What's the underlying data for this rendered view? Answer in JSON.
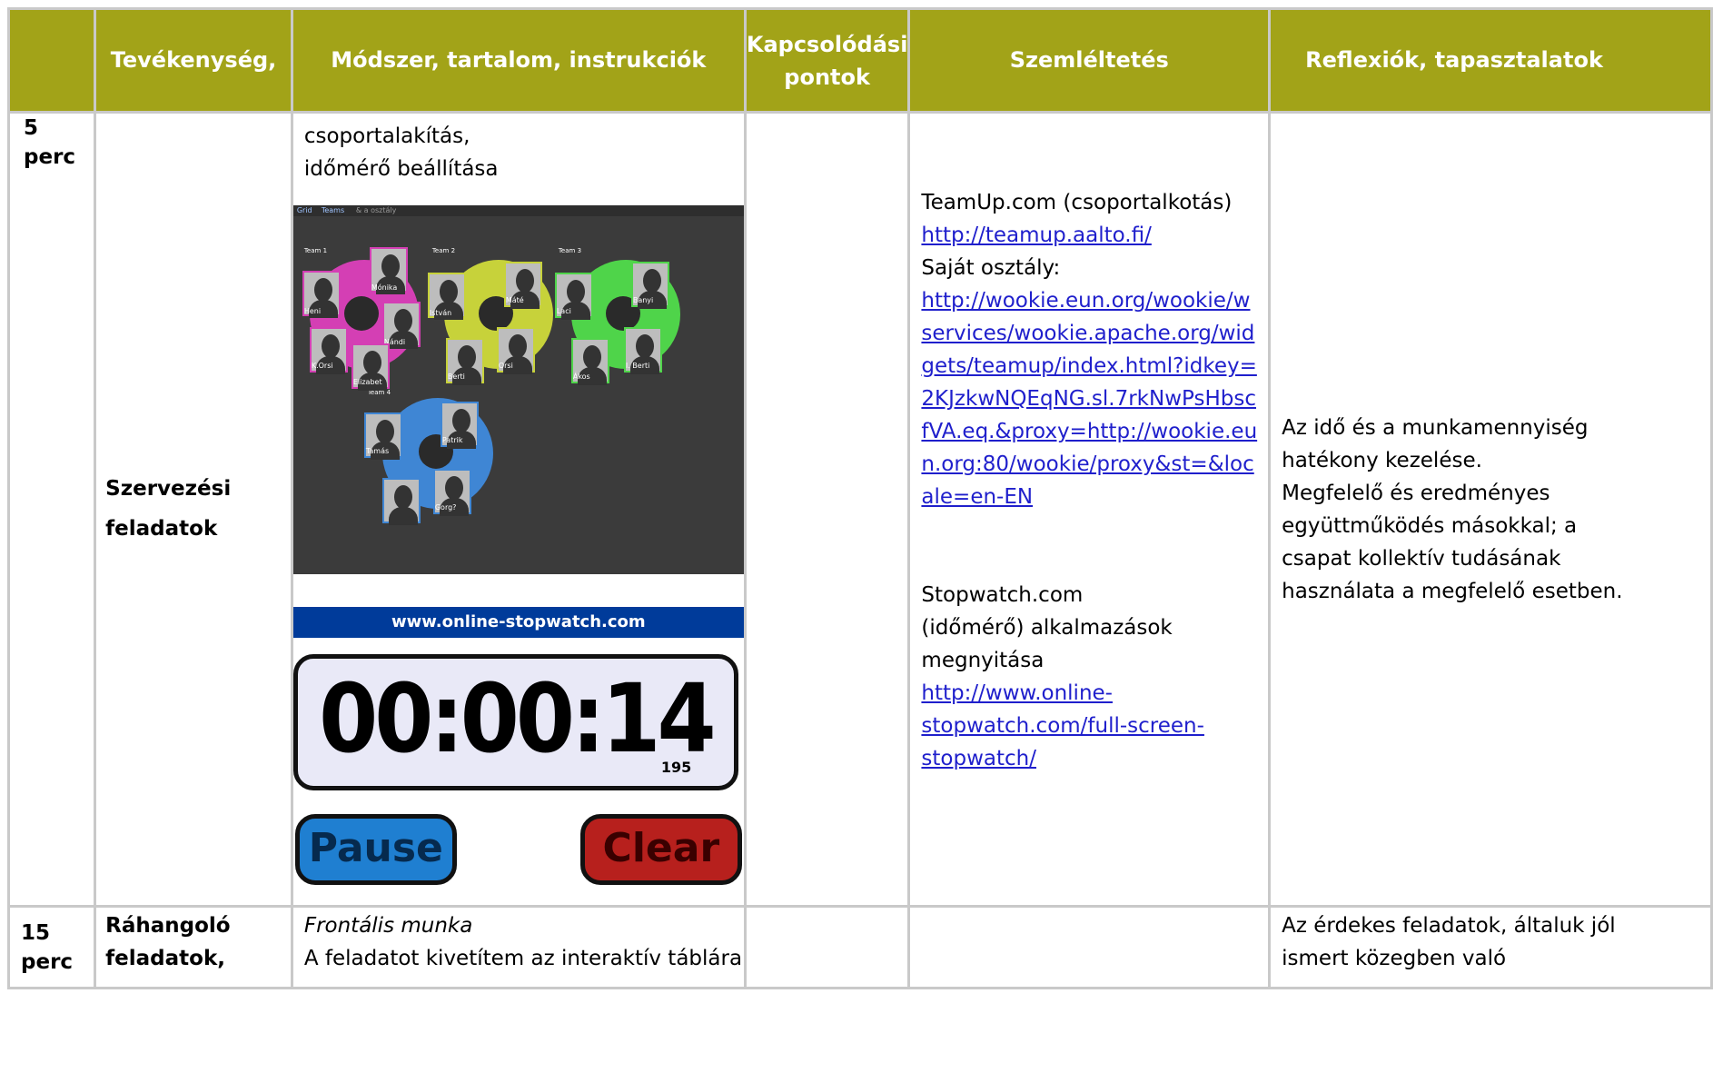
{
  "headers": [
    "",
    "Tevékenység,",
    "Módszer, tartalom, instrukciók",
    "Kapcsolódási pontok",
    "Szemléltetés",
    "Reflexiók, tapasztalatok"
  ],
  "header_kapcs": {
    "line1": "Kapcsolódási",
    "line2": "pontok"
  },
  "row1": {
    "time": "5 perc",
    "activity": "Szervezési feladatok",
    "method_lines": [
      "csoportalakítás,",
      "időmérő beállítása"
    ],
    "teamup_screenshot": {
      "toolbar": [
        "Grid",
        "Teams",
        "& a osztály"
      ],
      "teams": [
        "Team 1",
        "Team 2",
        "Team 3",
        "Team 4"
      ],
      "names": [
        "Heni",
        "Mónika",
        "Nándi",
        "K.Orsi",
        "Elizabet",
        "István",
        "Máté",
        "Berti",
        "Orsi",
        "Laci",
        "Banyi",
        "Ákos",
        "I. Berti",
        "Tamás",
        "Patrik",
        "Gorg?"
      ]
    },
    "stopwatch": {
      "site": "www.online-stopwatch.com",
      "time": "00:00:14",
      "ms": "195",
      "pause": "Pause",
      "clear": "Clear"
    },
    "illustration": {
      "teamup_label": "TeamUp.com (csoportalkotás)",
      "teamup_link": "http://teamup.aalto.fi/",
      "own_class": "Saját osztály:",
      "wookie_link_lines": [
        "http://wookie.eun.org/wookie/w",
        "services/wookie.apache.org/wid",
        "gets/teamup/index.html?idkey=",
        "2KJzkwNQEqNG.sl.7rkNwPsHbsc",
        "fVA.eq.&proxy=http://wookie.eu",
        "n.org:80/wookie/proxy&st=&loc",
        "ale=en-EN"
      ],
      "stopwatch_label_lines": [
        "Stopwatch.com",
        "(időmérő) alkalmazások",
        "megnyitása"
      ],
      "stopwatch_link_lines": [
        "http://www.online-",
        "stopwatch.com/full-screen-",
        "stopwatch/"
      ]
    },
    "reflection_lines": [
      "Az idő és a munkamennyiség",
      "hatékony kezelése.",
      "Megfelelő és eredményes",
      "együttműködés másokkal; a",
      "csapat kollektív tudásának",
      "használata a megfelelő esetben."
    ]
  },
  "row2": {
    "time": "15 perc",
    "activity_lines": [
      "Ráhangoló",
      "feladatok,"
    ],
    "method_lines": [
      "Frontális munka",
      "A feladatot kivetítem az interaktív táblára"
    ],
    "reflection_lines": [
      "Az érdekes feladatok, általuk jól",
      "ismert közegben való"
    ]
  },
  "colors": {
    "header_bg": "#a2a318",
    "link": "#1f1fcc",
    "border": "#c9c9c9"
  }
}
